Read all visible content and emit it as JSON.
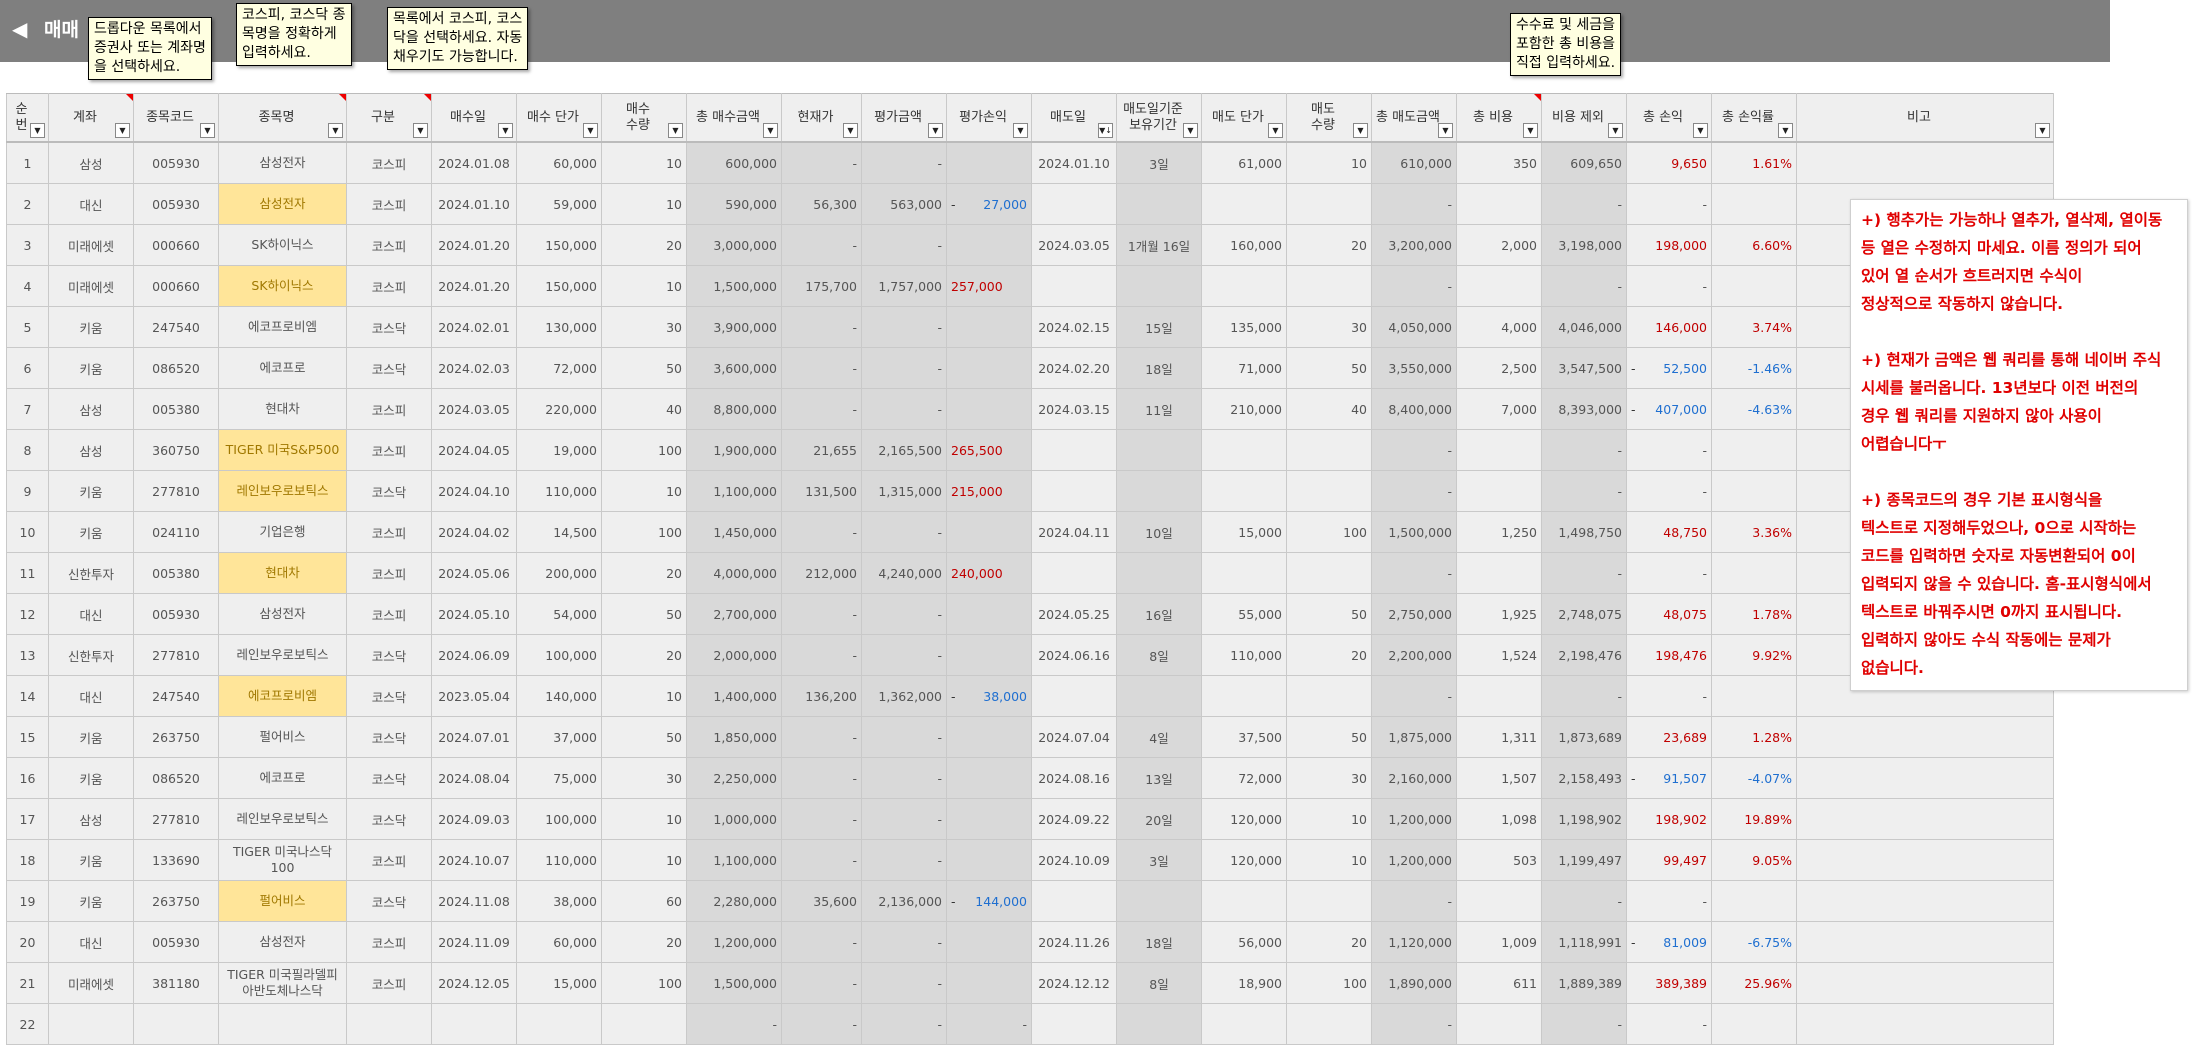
{
  "header": {
    "back_icon": "◀",
    "title": "매매"
  },
  "tooltips": {
    "account": "드롭다운 목록에서\n증권사 또는 계좌명\n을 선택하세요.",
    "stock_name": "코스피, 코스닥 종\n목명을 정확하게\n입력하세요.",
    "market": "목록에서 코스피, 코스\n닥을 선택하세요. 자동\n채우기도 가능합니다.",
    "total_cost": "수수료 및 세금을\n포함한 총 비용을\n직접 입력하세요."
  },
  "columns": [
    "순번",
    "계좌",
    "종목코드",
    "종목명",
    "구분",
    "매수일",
    "매수 단가",
    "매수\n수량",
    "총 매수금액",
    "현재가",
    "평가금액",
    "평가손익",
    "매도일",
    "매도일기준\n보유기간",
    "매도 단가",
    "매도\n수량",
    "총 매도금액",
    "총 비용",
    "비용 제외",
    "총 손익",
    "총 손익률",
    "비고"
  ],
  "rows": [
    {
      "no": "1",
      "account": "삼성",
      "code": "005930",
      "name": "삼성전자",
      "market": "코스피",
      "buy_date": "2024.01.08",
      "buy_price": "60,000",
      "buy_qty": "10",
      "buy_total": "600,000",
      "cur_price": "-",
      "eval_amt": "-",
      "eval_pl": "",
      "sell_date": "2024.01.10",
      "hold": "3일",
      "sell_price": "61,000",
      "sell_qty": "10",
      "sell_total": "610,000",
      "cost": "350",
      "net": "609,650",
      "pl": "9,650",
      "pl_rate": "1.61%"
    },
    {
      "no": "2",
      "account": "대신",
      "code": "005930",
      "name": "삼성전자",
      "market": "코스피",
      "buy_date": "2024.01.10",
      "buy_price": "59,000",
      "buy_qty": "10",
      "buy_total": "590,000",
      "cur_price": "56,300",
      "eval_amt": "563,000",
      "eval_pl": "27,000",
      "sell_date": "",
      "hold": "",
      "sell_price": "",
      "sell_qty": "",
      "sell_total": "-",
      "cost": "",
      "net": "-",
      "pl": "-",
      "pl_rate": ""
    },
    {
      "no": "3",
      "account": "미래에셋",
      "code": "000660",
      "name": "SK하이닉스",
      "market": "코스피",
      "buy_date": "2024.01.20",
      "buy_price": "150,000",
      "buy_qty": "20",
      "buy_total": "3,000,000",
      "cur_price": "-",
      "eval_amt": "-",
      "eval_pl": "",
      "sell_date": "2024.03.05",
      "hold": "1개월 16일",
      "sell_price": "160,000",
      "sell_qty": "20",
      "sell_total": "3,200,000",
      "cost": "2,000",
      "net": "3,198,000",
      "pl": "198,000",
      "pl_rate": "6.60%"
    },
    {
      "no": "4",
      "account": "미래에셋",
      "code": "000660",
      "name": "SK하이닉스",
      "market": "코스피",
      "buy_date": "2024.01.20",
      "buy_price": "150,000",
      "buy_qty": "10",
      "buy_total": "1,500,000",
      "cur_price": "175,700",
      "eval_amt": "1,757,000",
      "eval_pl": "257,000",
      "sell_date": "",
      "hold": "",
      "sell_price": "",
      "sell_qty": "",
      "sell_total": "-",
      "cost": "",
      "net": "-",
      "pl": "-",
      "pl_rate": ""
    },
    {
      "no": "5",
      "account": "키움",
      "code": "247540",
      "name": "에코프로비엠",
      "market": "코스닥",
      "buy_date": "2024.02.01",
      "buy_price": "130,000",
      "buy_qty": "30",
      "buy_total": "3,900,000",
      "cur_price": "-",
      "eval_amt": "-",
      "eval_pl": "",
      "sell_date": "2024.02.15",
      "hold": "15일",
      "sell_price": "135,000",
      "sell_qty": "30",
      "sell_total": "4,050,000",
      "cost": "4,000",
      "net": "4,046,000",
      "pl": "146,000",
      "pl_rate": "3.74%"
    },
    {
      "no": "6",
      "account": "키움",
      "code": "086520",
      "name": "에코프로",
      "market": "코스닥",
      "buy_date": "2024.02.03",
      "buy_price": "72,000",
      "buy_qty": "50",
      "buy_total": "3,600,000",
      "cur_price": "-",
      "eval_amt": "-",
      "eval_pl": "",
      "sell_date": "2024.02.20",
      "hold": "18일",
      "sell_price": "71,000",
      "sell_qty": "50",
      "sell_total": "3,550,000",
      "cost": "2,500",
      "net": "3,547,500",
      "pl": "52,500",
      "pl_rate": "-1.46%"
    },
    {
      "no": "7",
      "account": "삼성",
      "code": "005380",
      "name": "현대차",
      "market": "코스피",
      "buy_date": "2024.03.05",
      "buy_price": "220,000",
      "buy_qty": "40",
      "buy_total": "8,800,000",
      "cur_price": "-",
      "eval_amt": "-",
      "eval_pl": "",
      "sell_date": "2024.03.15",
      "hold": "11일",
      "sell_price": "210,000",
      "sell_qty": "40",
      "sell_total": "8,400,000",
      "cost": "7,000",
      "net": "8,393,000",
      "pl": "407,000",
      "pl_rate": "-4.63%"
    },
    {
      "no": "8",
      "account": "삼성",
      "code": "360750",
      "name": "TIGER 미국S&P500",
      "market": "코스피",
      "buy_date": "2024.04.05",
      "buy_price": "19,000",
      "buy_qty": "100",
      "buy_total": "1,900,000",
      "cur_price": "21,655",
      "eval_amt": "2,165,500",
      "eval_pl": "265,500",
      "sell_date": "",
      "hold": "",
      "sell_price": "",
      "sell_qty": "",
      "sell_total": "-",
      "cost": "",
      "net": "-",
      "pl": "-",
      "pl_rate": ""
    },
    {
      "no": "9",
      "account": "키움",
      "code": "277810",
      "name": "레인보우로보틱스",
      "market": "코스닥",
      "buy_date": "2024.04.10",
      "buy_price": "110,000",
      "buy_qty": "10",
      "buy_total": "1,100,000",
      "cur_price": "131,500",
      "eval_amt": "1,315,000",
      "eval_pl": "215,000",
      "sell_date": "",
      "hold": "",
      "sell_price": "",
      "sell_qty": "",
      "sell_total": "-",
      "cost": "",
      "net": "-",
      "pl": "-",
      "pl_rate": ""
    },
    {
      "no": "10",
      "account": "키움",
      "code": "024110",
      "name": "기업은행",
      "market": "코스피",
      "buy_date": "2024.04.02",
      "buy_price": "14,500",
      "buy_qty": "100",
      "buy_total": "1,450,000",
      "cur_price": "-",
      "eval_amt": "-",
      "eval_pl": "",
      "sell_date": "2024.04.11",
      "hold": "10일",
      "sell_price": "15,000",
      "sell_qty": "100",
      "sell_total": "1,500,000",
      "cost": "1,250",
      "net": "1,498,750",
      "pl": "48,750",
      "pl_rate": "3.36%"
    },
    {
      "no": "11",
      "account": "신한투자",
      "code": "005380",
      "name": "현대차",
      "market": "코스피",
      "buy_date": "2024.05.06",
      "buy_price": "200,000",
      "buy_qty": "20",
      "buy_total": "4,000,000",
      "cur_price": "212,000",
      "eval_amt": "4,240,000",
      "eval_pl": "240,000",
      "sell_date": "",
      "hold": "",
      "sell_price": "",
      "sell_qty": "",
      "sell_total": "-",
      "cost": "",
      "net": "-",
      "pl": "-",
      "pl_rate": ""
    },
    {
      "no": "12",
      "account": "대신",
      "code": "005930",
      "name": "삼성전자",
      "market": "코스피",
      "buy_date": "2024.05.10",
      "buy_price": "54,000",
      "buy_qty": "50",
      "buy_total": "2,700,000",
      "cur_price": "-",
      "eval_amt": "-",
      "eval_pl": "",
      "sell_date": "2024.05.25",
      "hold": "16일",
      "sell_price": "55,000",
      "sell_qty": "50",
      "sell_total": "2,750,000",
      "cost": "1,925",
      "net": "2,748,075",
      "pl": "48,075",
      "pl_rate": "1.78%"
    },
    {
      "no": "13",
      "account": "신한투자",
      "code": "277810",
      "name": "레인보우로보틱스",
      "market": "코스닥",
      "buy_date": "2024.06.09",
      "buy_price": "100,000",
      "buy_qty": "20",
      "buy_total": "2,000,000",
      "cur_price": "-",
      "eval_amt": "-",
      "eval_pl": "",
      "sell_date": "2024.06.16",
      "hold": "8일",
      "sell_price": "110,000",
      "sell_qty": "20",
      "sell_total": "2,200,000",
      "cost": "1,524",
      "net": "2,198,476",
      "pl": "198,476",
      "pl_rate": "9.92%"
    },
    {
      "no": "14",
      "account": "대신",
      "code": "247540",
      "name": "에코프로비엠",
      "market": "코스닥",
      "buy_date": "2023.05.04",
      "buy_price": "140,000",
      "buy_qty": "10",
      "buy_total": "1,400,000",
      "cur_price": "136,200",
      "eval_amt": "1,362,000",
      "eval_pl": "38,000",
      "sell_date": "",
      "hold": "",
      "sell_price": "",
      "sell_qty": "",
      "sell_total": "-",
      "cost": "",
      "net": "-",
      "pl": "-",
      "pl_rate": ""
    },
    {
      "no": "15",
      "account": "키움",
      "code": "263750",
      "name": "펄어비스",
      "market": "코스닥",
      "buy_date": "2024.07.01",
      "buy_price": "37,000",
      "buy_qty": "50",
      "buy_total": "1,850,000",
      "cur_price": "-",
      "eval_amt": "-",
      "eval_pl": "",
      "sell_date": "2024.07.04",
      "hold": "4일",
      "sell_price": "37,500",
      "sell_qty": "50",
      "sell_total": "1,875,000",
      "cost": "1,311",
      "net": "1,873,689",
      "pl": "23,689",
      "pl_rate": "1.28%"
    },
    {
      "no": "16",
      "account": "키움",
      "code": "086520",
      "name": "에코프로",
      "market": "코스닥",
      "buy_date": "2024.08.04",
      "buy_price": "75,000",
      "buy_qty": "30",
      "buy_total": "2,250,000",
      "cur_price": "-",
      "eval_amt": "-",
      "eval_pl": "",
      "sell_date": "2024.08.16",
      "hold": "13일",
      "sell_price": "72,000",
      "sell_qty": "30",
      "sell_total": "2,160,000",
      "cost": "1,507",
      "net": "2,158,493",
      "pl": "91,507",
      "pl_rate": "-4.07%"
    },
    {
      "no": "17",
      "account": "삼성",
      "code": "277810",
      "name": "레인보우로보틱스",
      "market": "코스닥",
      "buy_date": "2024.09.03",
      "buy_price": "100,000",
      "buy_qty": "10",
      "buy_total": "1,000,000",
      "cur_price": "-",
      "eval_amt": "-",
      "eval_pl": "",
      "sell_date": "2024.09.22",
      "hold": "20일",
      "sell_price": "120,000",
      "sell_qty": "10",
      "sell_total": "1,200,000",
      "cost": "1,098",
      "net": "1,198,902",
      "pl": "198,902",
      "pl_rate": "19.89%"
    },
    {
      "no": "18",
      "account": "키움",
      "code": "133690",
      "name": "TIGER 미국나스닥\n100",
      "market": "코스피",
      "buy_date": "2024.10.07",
      "buy_price": "110,000",
      "buy_qty": "10",
      "buy_total": "1,100,000",
      "cur_price": "-",
      "eval_amt": "-",
      "eval_pl": "",
      "sell_date": "2024.10.09",
      "hold": "3일",
      "sell_price": "120,000",
      "sell_qty": "10",
      "sell_total": "1,200,000",
      "cost": "503",
      "net": "1,199,497",
      "pl": "99,497",
      "pl_rate": "9.05%"
    },
    {
      "no": "19",
      "account": "키움",
      "code": "263750",
      "name": "펄어비스",
      "market": "코스닥",
      "buy_date": "2024.11.08",
      "buy_price": "38,000",
      "buy_qty": "60",
      "buy_total": "2,280,000",
      "cur_price": "35,600",
      "eval_amt": "2,136,000",
      "eval_pl": "144,000",
      "sell_date": "",
      "hold": "",
      "sell_price": "",
      "sell_qty": "",
      "sell_total": "-",
      "cost": "",
      "net": "-",
      "pl": "-",
      "pl_rate": ""
    },
    {
      "no": "20",
      "account": "대신",
      "code": "005930",
      "name": "삼성전자",
      "market": "코스피",
      "buy_date": "2024.11.09",
      "buy_price": "60,000",
      "buy_qty": "20",
      "buy_total": "1,200,000",
      "cur_price": "-",
      "eval_amt": "-",
      "eval_pl": "",
      "sell_date": "2024.11.26",
      "hold": "18일",
      "sell_price": "56,000",
      "sell_qty": "20",
      "sell_total": "1,120,000",
      "cost": "1,009",
      "net": "1,118,991",
      "pl": "81,009",
      "pl_rate": "-6.75%"
    },
    {
      "no": "21",
      "account": "미래에셋",
      "code": "381180",
      "name": "TIGER 미국필라델피\n아반도체나스닥",
      "market": "코스피",
      "buy_date": "2024.12.05",
      "buy_price": "15,000",
      "buy_qty": "100",
      "buy_total": "1,500,000",
      "cur_price": "-",
      "eval_amt": "-",
      "eval_pl": "",
      "sell_date": "2024.12.12",
      "hold": "8일",
      "sell_price": "18,900",
      "sell_qty": "100",
      "sell_total": "1,890,000",
      "cost": "611",
      "net": "1,889,389",
      "pl": "389,389",
      "pl_rate": "25.96%"
    },
    {
      "no": "22",
      "account": "",
      "code": "",
      "name": "",
      "market": "",
      "buy_date": "",
      "buy_price": "",
      "buy_qty": "",
      "buy_total": "-",
      "cur_price": "-",
      "eval_amt": "-",
      "eval_pl": "-",
      "sell_date": "",
      "hold": "",
      "sell_price": "",
      "sell_qty": "",
      "sell_total": "-",
      "cost": "",
      "net": "-",
      "pl": "-",
      "pl_rate": ""
    }
  ],
  "notes": [
    "+) 행추가는 가능하나 열추가, 열삭제, 열이동\n등 열은 수정하지 마세요. 이름 정의가 되어\n있어 열 순서가 흐트러지면 수식이\n정상적으로 작동하지 않습니다.",
    "+) 현재가 금액은 웹 쿼리를 통해 네이버 주식\n시세를 불러옵니다. 13년보다 이전 버전의\n경우 웹 쿼리를 지원하지 않아 사용이\n어렵습니다ㅜ",
    "+) 종목코드의 경우 기본 표시형식을\n텍스트로 지정해두었으나, 0으로 시작하는\n코드를 입력하면 숫자로 자동변환되어 0이\n입력되지 않을 수 있습니다. 홈-표시형식에서\n텍스트로 바꿔주시면 0까지 표시됩니다.\n입력하지 않아도 수식 작동에는 문제가\n없습니다."
  ],
  "colors": {
    "profit": "#c00000",
    "loss": "#1f6fd0",
    "highlight": "#ffe599",
    "gray": "#d9d9d9"
  },
  "icons": {
    "filter": "filter-dropdown-icon",
    "sort": "sort-desc-icon"
  }
}
